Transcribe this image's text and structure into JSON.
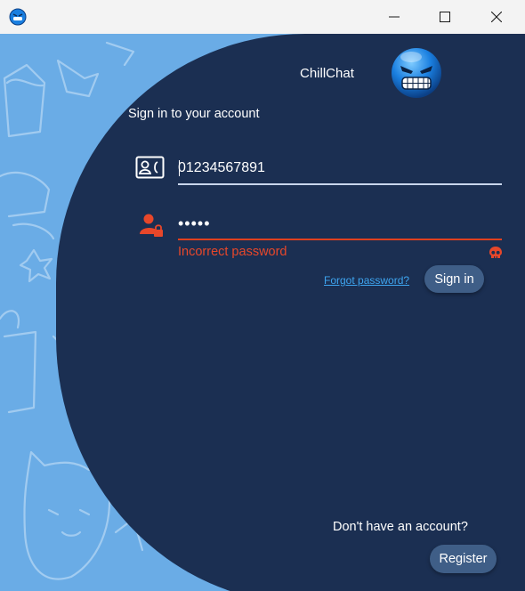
{
  "window": {
    "title_icon": "chillchat-app-icon",
    "controls": {
      "minimize": "minimize-icon",
      "maximize": "maximize-icon",
      "close": "close-icon"
    }
  },
  "brand": {
    "name": "ChillChat",
    "mascot": "grinning-blue-face-icon"
  },
  "login": {
    "heading": "Sign in to your account",
    "phone_value": "01234567891",
    "password_mask": "•••••",
    "error_message": "Incorrect password",
    "forgot_link": "Forgot password?",
    "signin_label": "Sign in"
  },
  "footer": {
    "prompt": "Don't have an account?",
    "register_label": "Register"
  },
  "colors": {
    "panel": "#1b2f52",
    "background": "#6aace6",
    "error": "#e8472a",
    "button": "#3f5e87",
    "link": "#3ea5f0"
  }
}
